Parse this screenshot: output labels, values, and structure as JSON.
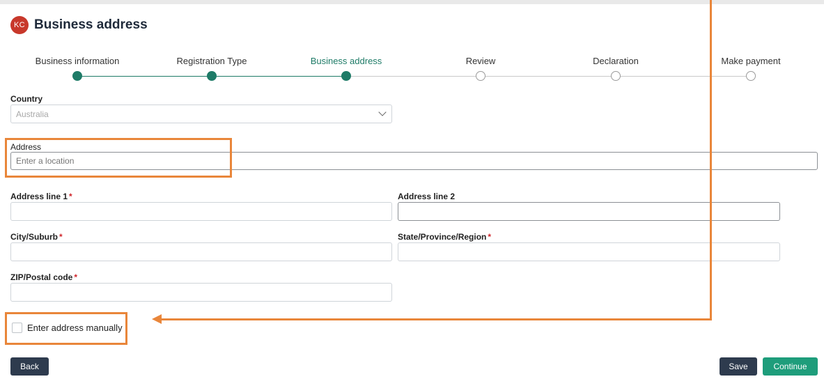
{
  "header": {
    "avatar_initials": "KC",
    "title": "Business address"
  },
  "stepper": {
    "steps": [
      {
        "label": "Business information",
        "status": "done"
      },
      {
        "label": "Registration Type",
        "status": "done"
      },
      {
        "label": "Business address",
        "status": "current"
      },
      {
        "label": "Review",
        "status": "pending"
      },
      {
        "label": "Declaration",
        "status": "pending"
      },
      {
        "label": "Make payment",
        "status": "pending"
      }
    ]
  },
  "form": {
    "country": {
      "label": "Country",
      "value": "Australia"
    },
    "address": {
      "label": "Address",
      "placeholder": "Enter a location"
    },
    "address_line1": {
      "label": "Address line 1",
      "required_mark": "*"
    },
    "address_line2": {
      "label": "Address line 2"
    },
    "city": {
      "label": "City/Suburb",
      "required_mark": "*"
    },
    "state": {
      "label": "State/Province/Region",
      "required_mark": "*"
    },
    "zip": {
      "label": "ZIP/Postal code",
      "required_mark": "*"
    },
    "manual_checkbox": {
      "label": "Enter address manually",
      "checked": false
    }
  },
  "buttons": {
    "back": "Back",
    "save": "Save",
    "continue": "Continue"
  },
  "colors": {
    "accent": "#1e7b67",
    "annotation": "#e9863a",
    "button_dark": "#2e3b4e",
    "button_green": "#1e9d7b"
  }
}
